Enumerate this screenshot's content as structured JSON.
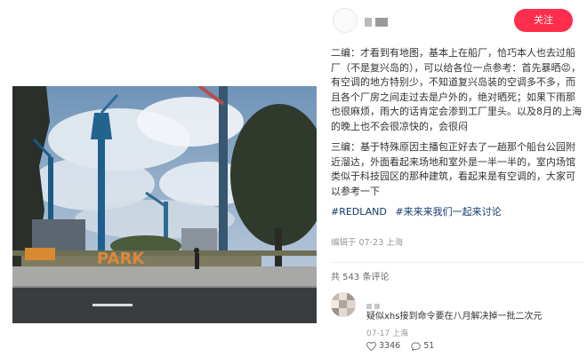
{
  "post": {
    "follow_label": "关注",
    "paragraph1": "二编：才看到有地图，基本上在船厂，恰巧本人也去过船厂（不是复兴岛的），可以给各位一点参考：首先暴晒😡，有空调的地方特别少，不知道复兴岛装的空调多不多，而且各个厂房之间走过去是户外的，绝对晒死；如果下雨那也很麻烦，雨大的话肯定会渗到工厂里头。以及8月的上海的晚上也不会很凉快的，会很闷",
    "paragraph2": "三编：基于特殊原因主播包正好去了一趟那个船台公园附近溜达，外面看起来场地和室外是一半一半的，室内场馆类似于科技园区的那种建筑，看起来是有空调的，大家可以参考一下",
    "hashtags": [
      "#REDLAND",
      "#来来来我们一起来讨论"
    ],
    "meta": "编辑于 07-23 上海",
    "comments_count": "共 543 条评论"
  },
  "photo": {
    "sign_text": "PARK"
  },
  "comment": {
    "text": "疑似xhs接到命令要在八月解决掉一批二次元",
    "time": "07-17 上海",
    "likes": "3346",
    "replies": "51"
  },
  "icons": {
    "heart": "heart-icon",
    "reply": "comment-bubble-icon"
  },
  "colors": {
    "accent": "#ff2e4d",
    "hashtag": "#13386c"
  }
}
